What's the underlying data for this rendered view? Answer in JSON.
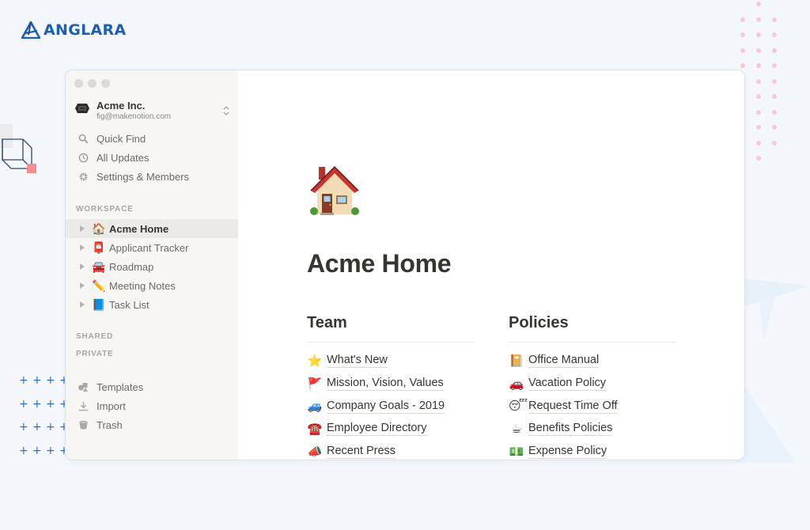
{
  "brand": {
    "name": "ANGLARA",
    "color": "#1d5fb3"
  },
  "window": {
    "workspace": {
      "name": "Acme Inc.",
      "email": "fig@makenotion.com"
    },
    "sidebar": {
      "nav": [
        {
          "icon": "search-icon",
          "label": "Quick Find"
        },
        {
          "icon": "clock-icon",
          "label": "All Updates"
        },
        {
          "icon": "gear-icon",
          "label": "Settings & Members"
        }
      ],
      "sections": {
        "workspace": "WORKSPACE",
        "shared": "SHARED",
        "private": "PRIVATE"
      },
      "pages": [
        {
          "emoji": "🏠",
          "icon": "house-icon",
          "label": "Acme Home",
          "active": true
        },
        {
          "emoji": "📮",
          "icon": "postbox-icon",
          "label": "Applicant Tracker"
        },
        {
          "emoji": "🚘",
          "icon": "car-icon",
          "label": "Roadmap"
        },
        {
          "emoji": "✏️",
          "icon": "pencil-icon",
          "label": "Meeting Notes"
        },
        {
          "emoji": "📘",
          "icon": "blue-book-icon",
          "label": "Task List"
        }
      ],
      "tools": [
        {
          "icon": "templates-icon",
          "label": "Templates"
        },
        {
          "icon": "import-icon",
          "label": "Import"
        },
        {
          "icon": "trash-icon",
          "label": "Trash"
        }
      ]
    },
    "page": {
      "icon": "house-icon",
      "title": "Acme Home",
      "columns": [
        {
          "heading": "Team",
          "links": [
            {
              "emoji": "⭐",
              "icon": "star-icon",
              "label": "What's New"
            },
            {
              "emoji": "🚩",
              "icon": "flag-icon",
              "label": "Mission, Vision, Values"
            },
            {
              "emoji": "🚙",
              "icon": "suv-icon",
              "label": "Company Goals - 2019"
            },
            {
              "emoji": "☎️",
              "icon": "telephone-icon",
              "label": "Employee Directory"
            },
            {
              "emoji": "📣",
              "icon": "megaphone-icon",
              "label": "Recent Press"
            }
          ]
        },
        {
          "heading": "Policies",
          "links": [
            {
              "emoji": "📔",
              "icon": "notebook-icon",
              "label": "Office Manual"
            },
            {
              "emoji": "🚗",
              "icon": "car-icon",
              "label": "Vacation Policy"
            },
            {
              "emoji": "😴",
              "icon": "sleeping-face-icon",
              "label": "Request Time Off"
            },
            {
              "emoji": "☕",
              "icon": "coffee-icon",
              "label": "Benefits Policies"
            },
            {
              "emoji": "💵",
              "icon": "money-icon",
              "label": "Expense Policy"
            }
          ]
        }
      ]
    }
  }
}
